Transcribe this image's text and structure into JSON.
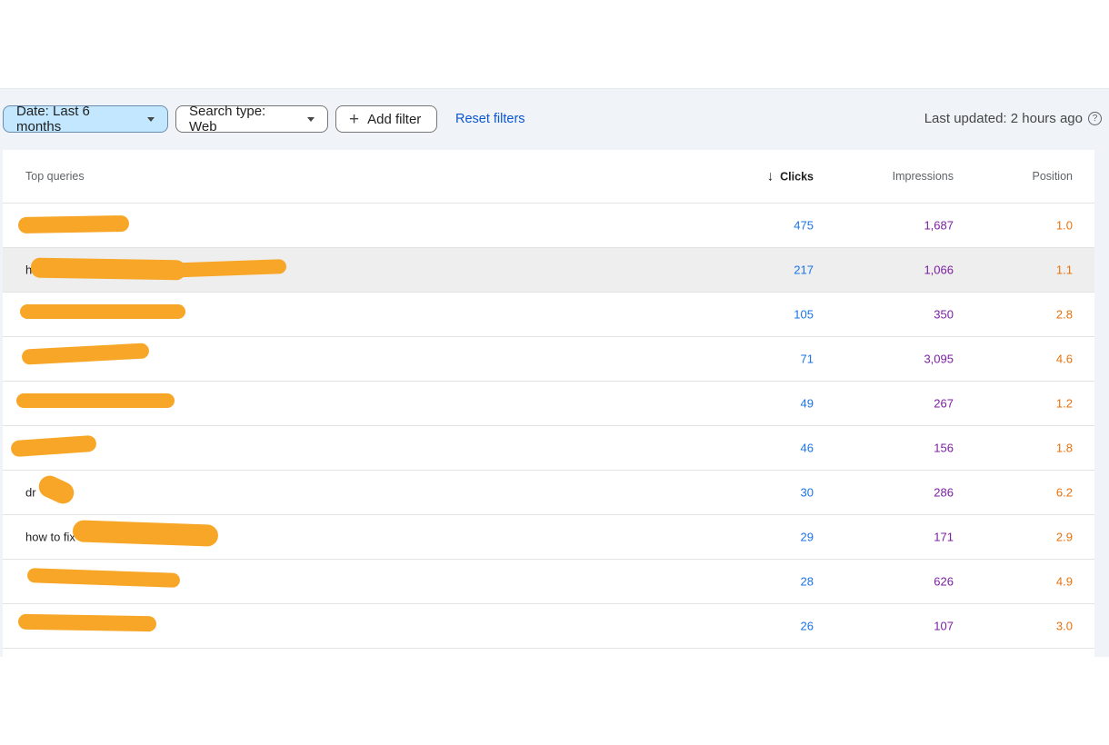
{
  "filters": {
    "date_label": "Date: Last 6 months",
    "search_type_label": "Search type: Web",
    "add_filter_label": "Add filter",
    "reset_label": "Reset filters"
  },
  "status": {
    "last_updated": "Last updated: 2 hours ago",
    "help_icon": "?"
  },
  "table": {
    "headers": {
      "query": "Top queries",
      "sort_icon": "↓",
      "clicks": "Clicks",
      "impressions": "Impressions",
      "position": "Position"
    },
    "rows": [
      {
        "query": "",
        "clicks": "475",
        "impressions": "1,687",
        "position": "1.0"
      },
      {
        "query": "h",
        "clicks": "217",
        "impressions": "1,066",
        "position": "1.1"
      },
      {
        "query": "",
        "clicks": "105",
        "impressions": "350",
        "position": "2.8"
      },
      {
        "query": "",
        "clicks": "71",
        "impressions": "3,095",
        "position": "4.6"
      },
      {
        "query": "",
        "clicks": "49",
        "impressions": "267",
        "position": "1.2"
      },
      {
        "query": "",
        "clicks": "46",
        "impressions": "156",
        "position": "1.8"
      },
      {
        "query": "dr",
        "clicks": "30",
        "impressions": "286",
        "position": "6.2"
      },
      {
        "query": "how to fix",
        "clicks": "29",
        "impressions": "171",
        "position": "2.9"
      },
      {
        "query": "",
        "clicks": "28",
        "impressions": "626",
        "position": "4.9"
      },
      {
        "query": "",
        "clicks": "26",
        "impressions": "107",
        "position": "3.0"
      }
    ]
  },
  "colors": {
    "clicks": "#1a73e8",
    "impressions": "#7b1fa2",
    "position": "#e8710a",
    "redaction": "#f7a627",
    "active_chip": "#c2e7ff"
  }
}
